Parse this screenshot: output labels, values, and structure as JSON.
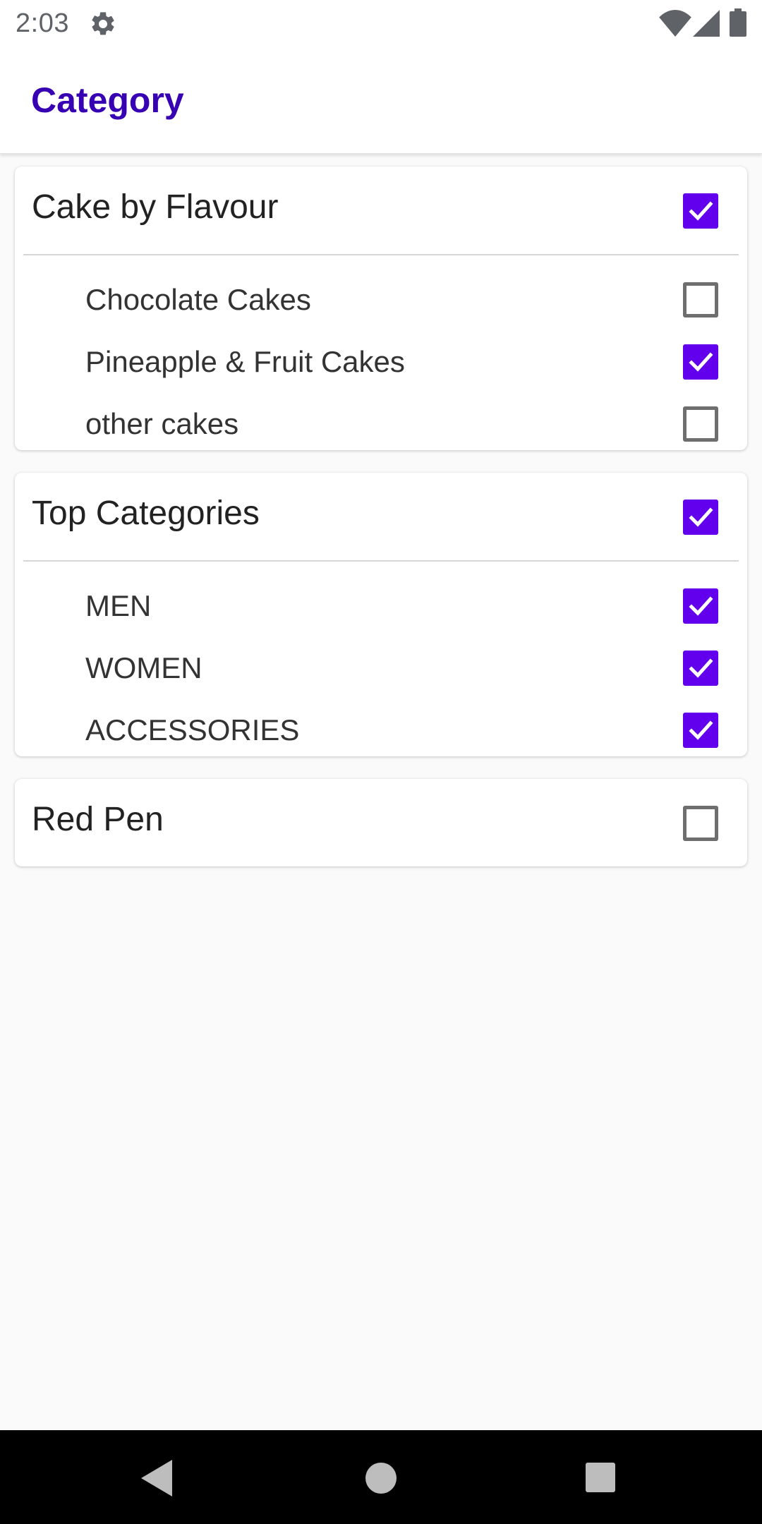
{
  "status_bar": {
    "time": "2:03",
    "icons": [
      "gear-icon",
      "wifi-icon",
      "cellular-signal-icon",
      "battery-icon"
    ]
  },
  "app_bar": {
    "title": "Category",
    "title_color": "#3700b3"
  },
  "accent_color": "#6200ee",
  "categories": [
    {
      "title": "Cake by Flavour",
      "checked": true,
      "items": [
        {
          "label": "Chocolate Cakes",
          "checked": false
        },
        {
          "label": "Pineapple & Fruit Cakes",
          "checked": true
        },
        {
          "label": "other cakes",
          "checked": false
        }
      ]
    },
    {
      "title": "Top Categories",
      "checked": true,
      "items": [
        {
          "label": "MEN",
          "checked": true
        },
        {
          "label": "WOMEN",
          "checked": true
        },
        {
          "label": "ACCESSORIES",
          "checked": true
        }
      ]
    },
    {
      "title": "Red Pen",
      "checked": false,
      "items": []
    }
  ],
  "nav_bar": {
    "icons": [
      "back-icon",
      "home-icon",
      "recents-icon"
    ]
  }
}
